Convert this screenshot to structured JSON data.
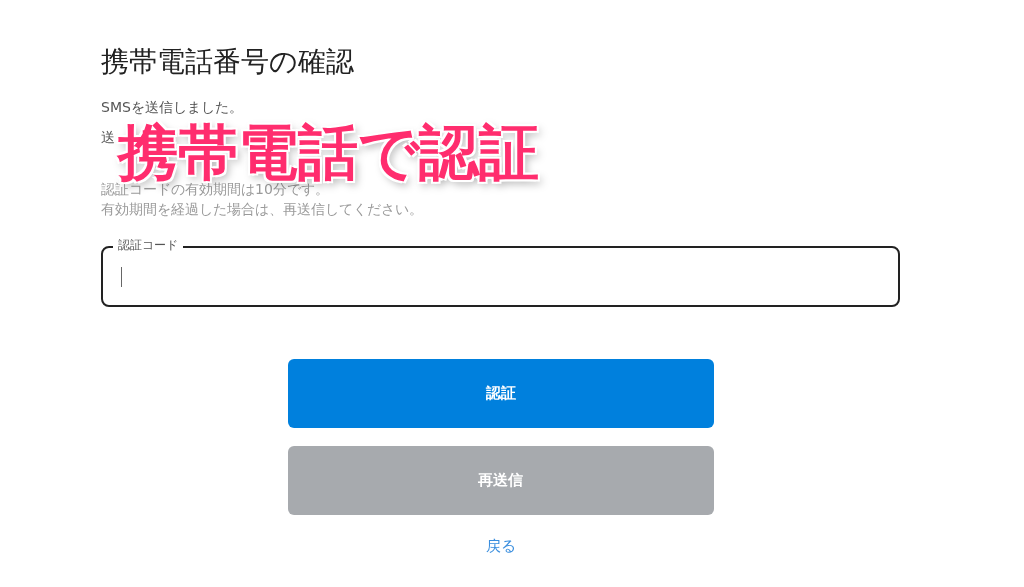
{
  "title": "携帯電話番号の確認",
  "messages": [
    {
      "text": "SMSを送信しました。",
      "muted": false
    },
    {
      "text": "送",
      "muted": false
    },
    {
      "text": "認証コードの有効期間は10分です。",
      "muted": true
    },
    {
      "text": "有効期間を経過した場合は、再送信してください。",
      "muted": true
    }
  ],
  "code_field": {
    "label": "認証コード",
    "focused": true
  },
  "buttons": [
    {
      "label": "認証",
      "kind": "primary"
    },
    {
      "label": "再送信",
      "kind": "secondary"
    }
  ],
  "back_link": "戻る",
  "overlay_caption": "携帯電話で認証"
}
